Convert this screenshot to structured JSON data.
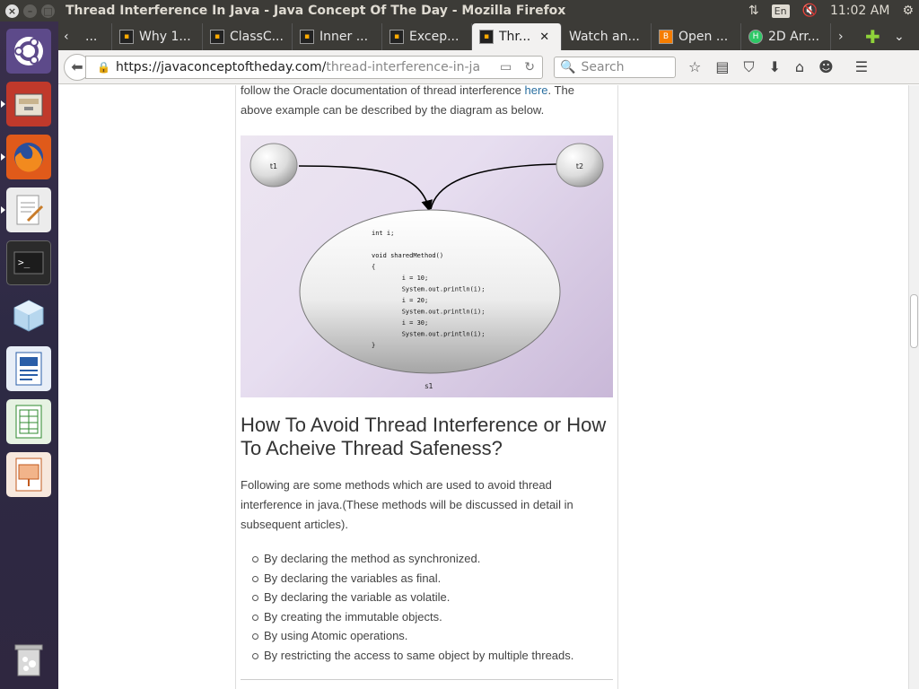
{
  "window": {
    "title": "Thread Interference In Java - Java Concept Of The Day - Mozilla Firefox",
    "lang": "En",
    "time": "11:02 AM"
  },
  "tabs": [
    {
      "label": "...",
      "icon": "black-square-icon"
    },
    {
      "label": "Why 1...",
      "icon": "black-square-icon"
    },
    {
      "label": "ClassC...",
      "icon": "black-square-icon"
    },
    {
      "label": "Inner ...",
      "icon": "black-square-icon"
    },
    {
      "label": "Excep...",
      "icon": "black-square-icon"
    },
    {
      "label": "Thr...",
      "icon": "black-square-icon",
      "active": true
    },
    {
      "label": "Watch an...",
      "icon": "none"
    },
    {
      "label": "Open ...",
      "icon": "blogger-icon"
    },
    {
      "label": "2D Arr...",
      "icon": "hackerrank-icon"
    }
  ],
  "nav": {
    "url_host": "https://javaconceptoftheday.com/",
    "url_path": "thread-interference-in-ja",
    "search_placeholder": "Search"
  },
  "article": {
    "intro_line1_pre": "follow the Oracle documentation of thread interference ",
    "intro_link": "here",
    "intro_line1_post": ". The",
    "intro_line2": "above example can be described by the diagram as below.",
    "diagram": {
      "node_t1": "t1",
      "node_t2": "t2",
      "node_s1": "s1",
      "code": [
        "int i;",
        "",
        "void sharedMethod()",
        "{",
        "        i = 10;",
        "        System.out.println(i);",
        "        i = 20;",
        "        System.out.println(i);",
        "        i = 30;",
        "        System.out.println(i);",
        "}"
      ]
    },
    "heading": "How To Avoid Thread Interference or How To Acheive Thread Safeness?",
    "para2": "Following are some methods which are used to avoid thread interference in java.(These methods will be discussed in detail in subsequent articles).",
    "methods": [
      "By declaring the method as synchronized.",
      "By declaring the variables as final.",
      "By declaring the variable as volatile.",
      "By creating the immutable objects.",
      "By using Atomic operations.",
      "By restricting the access to same object by multiple threads."
    ]
  }
}
